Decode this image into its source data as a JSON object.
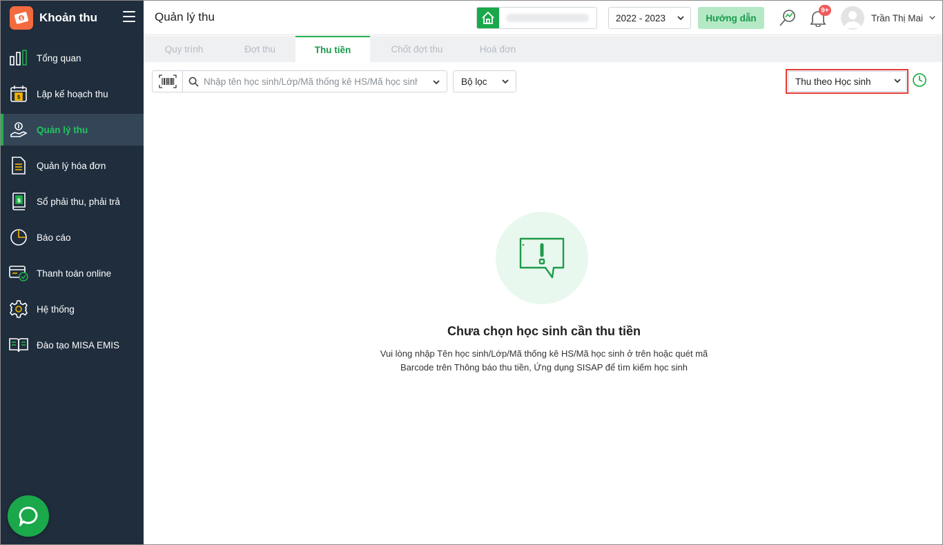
{
  "app": {
    "title": "Khoản thu"
  },
  "sidebar": {
    "items": [
      {
        "label": "Tổng quan",
        "icon": "chart-bars-icon"
      },
      {
        "label": "Lập kế hoạch thu",
        "icon": "calendar-money-icon"
      },
      {
        "label": "Quản lý thu",
        "icon": "hand-coin-icon",
        "active": true
      },
      {
        "label": "Quản lý hóa đơn",
        "icon": "document-icon"
      },
      {
        "label": "Sổ phải thu, phải trả",
        "icon": "ledger-book-icon"
      },
      {
        "label": "Báo cáo",
        "icon": "pie-chart-icon"
      },
      {
        "label": "Thanh toán online",
        "icon": "card-check-icon"
      },
      {
        "label": "Hệ thống",
        "icon": "gear-icon"
      },
      {
        "label": "Đào tạo MISA EMIS",
        "icon": "open-book-icon"
      }
    ]
  },
  "header": {
    "page_title": "Quản lý thu",
    "school_year": "2022 - 2023",
    "guide_label": "Hướng dẫn",
    "notification_badge": "9+",
    "user_name": "Trần Thị Mai"
  },
  "tabs": [
    {
      "label": "Quy trình"
    },
    {
      "label": "Đợt thu"
    },
    {
      "label": "Thu tiền",
      "active": true
    },
    {
      "label": "Chốt đợt thu"
    },
    {
      "label": "Hoá đơn"
    }
  ],
  "toolbar": {
    "search_placeholder": "Nhập tên học sinh/Lớp/Mã thống kê HS/Mã học sinh",
    "filter_label": "Bộ lọc",
    "mode_label": "Thu theo Học sinh"
  },
  "empty_state": {
    "title": "Chưa chọn học sinh cần thu tiền",
    "desc_line1": "Vui lòng nhập Tên học sinh/Lớp/Mã thống kê HS/Mã học sinh ở trên hoặc quét mã",
    "desc_line2": "Barcode trên Thông báo thu tiền, Ứng dụng SISAP để tìm kiếm học sinh"
  },
  "colors": {
    "sidebar_bg": "#1f2d3d",
    "accent_green": "#22b14c",
    "brand_orange": "#f26a3d",
    "highlight_red": "#e53935"
  }
}
